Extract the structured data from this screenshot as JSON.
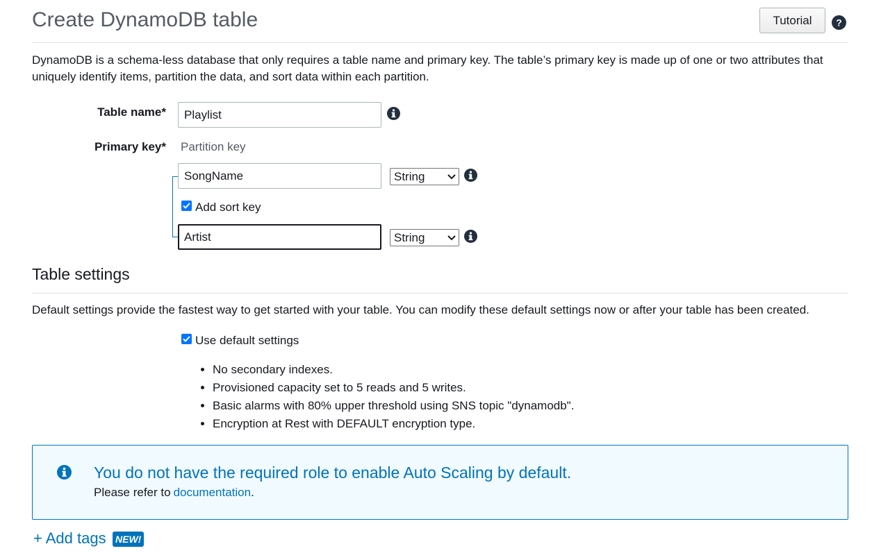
{
  "header": {
    "title": "Create DynamoDB table",
    "tutorial_label": "Tutorial"
  },
  "intro": "DynamoDB is a schema-less database that only requires a table name and primary key. The table’s primary key is made up of one or two attributes that uniquely identify items, partition the data, and sort data within each partition.",
  "form": {
    "table_name_label": "Table name*",
    "table_name_value": "Playlist",
    "primary_key_label": "Primary key*",
    "partition_key_label": "Partition key",
    "partition_key_value": "SongName",
    "partition_key_type": "String",
    "add_sort_key_label": "Add sort key",
    "add_sort_key_checked": true,
    "sort_key_value": "Artist",
    "sort_key_type": "String"
  },
  "settings": {
    "title": "Table settings",
    "description": "Default settings provide the fastest way to get started with your table. You can modify these default settings now or after your table has been created.",
    "use_default_label": "Use default settings",
    "use_default_checked": true,
    "bullets": [
      "No secondary indexes.",
      "Provisioned capacity set to 5 reads and 5 writes.",
      "Basic alarms with 80% upper threshold using SNS topic \"dynamodb\".",
      "Encryption at Rest with DEFAULT encryption type."
    ]
  },
  "alert": {
    "title": "You do not have the required role to enable Auto Scaling by default.",
    "body_prefix": "Please refer to",
    "link_label": "documentation",
    "body_suffix": "."
  },
  "tags": {
    "add_label": "+ Add tags",
    "badge": "NEW!"
  },
  "colors": {
    "accent": "#0073bb",
    "checkbox": "#0075ff",
    "alert_bg": "#f1faff"
  }
}
